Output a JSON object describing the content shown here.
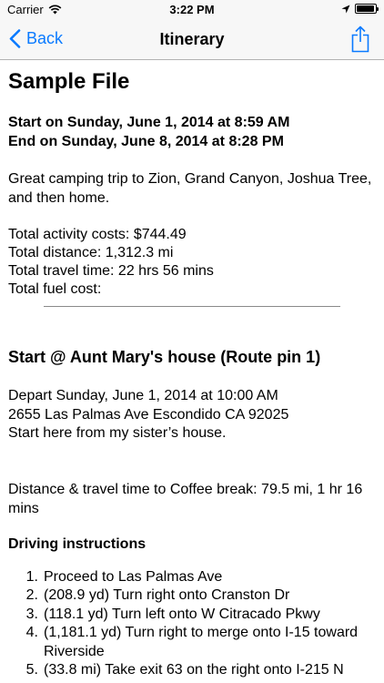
{
  "status": {
    "carrier": "Carrier",
    "time": "3:22 PM",
    "battery_level": 0.95
  },
  "nav": {
    "back_label": "Back",
    "title": "Itinerary",
    "share_icon": "share-icon"
  },
  "document": {
    "title": "Sample File",
    "start": "Start on Sunday, June 1, 2014 at 8:59 AM",
    "end": "End on Sunday, June 8, 2014 at 8:28 PM",
    "description": "Great camping trip to Zion, Grand Canyon, Joshua Tree, and then home.",
    "totals": [
      "Total activity costs: $744.49",
      "Total distance: 1,312.3 mi",
      "Total travel time: 22 hrs 56 mins",
      "Total fuel cost:"
    ]
  },
  "section": {
    "title": "Start @ Aunt Mary's house (Route pin 1)",
    "depart": "Depart Sunday, June 1, 2014 at 10:00 AM",
    "address": "2655 Las Palmas Ave Escondido CA 92025",
    "note": "Start here from my sister’s house.",
    "distance": "Distance & travel time to Coffee break: 79.5 mi, 1 hr 16 mins",
    "driving_heading": "Driving instructions",
    "steps": [
      {
        "num": "1.",
        "text": "Proceed to Las Palmas Ave"
      },
      {
        "num": "2.",
        "text": "(208.9 yd) Turn right onto Cranston Dr"
      },
      {
        "num": "3.",
        "text": "(118.1 yd) Turn left onto W Citracado Pkwy"
      },
      {
        "num": "4.",
        "text": "(1,181.1 yd) Turn right to merge onto I-15 toward Riverside"
      },
      {
        "num": "5.",
        "text": "(33.8 mi) Take exit 63 on the right onto I-215 N"
      }
    ]
  }
}
